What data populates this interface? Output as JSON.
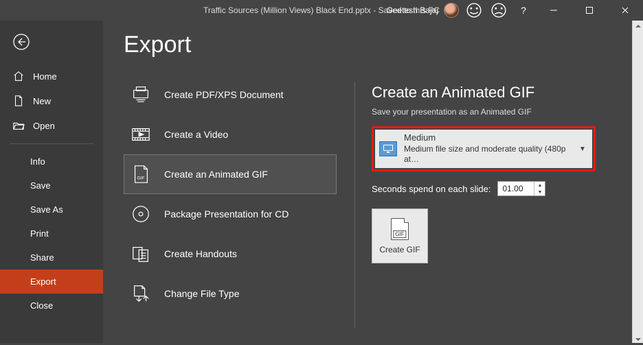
{
  "titlebar": {
    "title": "Traffic Sources (Million Views) Black End.pptx  -  Saved to this PC",
    "user_name": "Geetesh Bajaj",
    "help_label": "?"
  },
  "sidebar": {
    "primary": [
      {
        "label": "Home"
      },
      {
        "label": "New"
      },
      {
        "label": "Open"
      }
    ],
    "secondary": [
      {
        "label": "Info"
      },
      {
        "label": "Save"
      },
      {
        "label": "Save As"
      },
      {
        "label": "Print"
      },
      {
        "label": "Share"
      },
      {
        "label": "Export",
        "active": true
      },
      {
        "label": "Close"
      }
    ]
  },
  "page": {
    "title": "Export",
    "export_options": [
      {
        "label": "Create PDF/XPS Document"
      },
      {
        "label": "Create a Video"
      },
      {
        "label": "Create an Animated GIF",
        "selected": true
      },
      {
        "label": "Package Presentation for CD"
      },
      {
        "label": "Create Handouts"
      },
      {
        "label": "Change File Type"
      }
    ],
    "detail": {
      "heading": "Create an Animated GIF",
      "subheading": "Save your presentation as an Animated GIF",
      "quality": {
        "name": "Medium",
        "desc": "Medium file size and moderate quality (480p at…"
      },
      "seconds_label": "Seconds spend on each slide:",
      "seconds_value": "01.00",
      "create_button": "Create GIF",
      "gif_badge": "GIF"
    }
  }
}
